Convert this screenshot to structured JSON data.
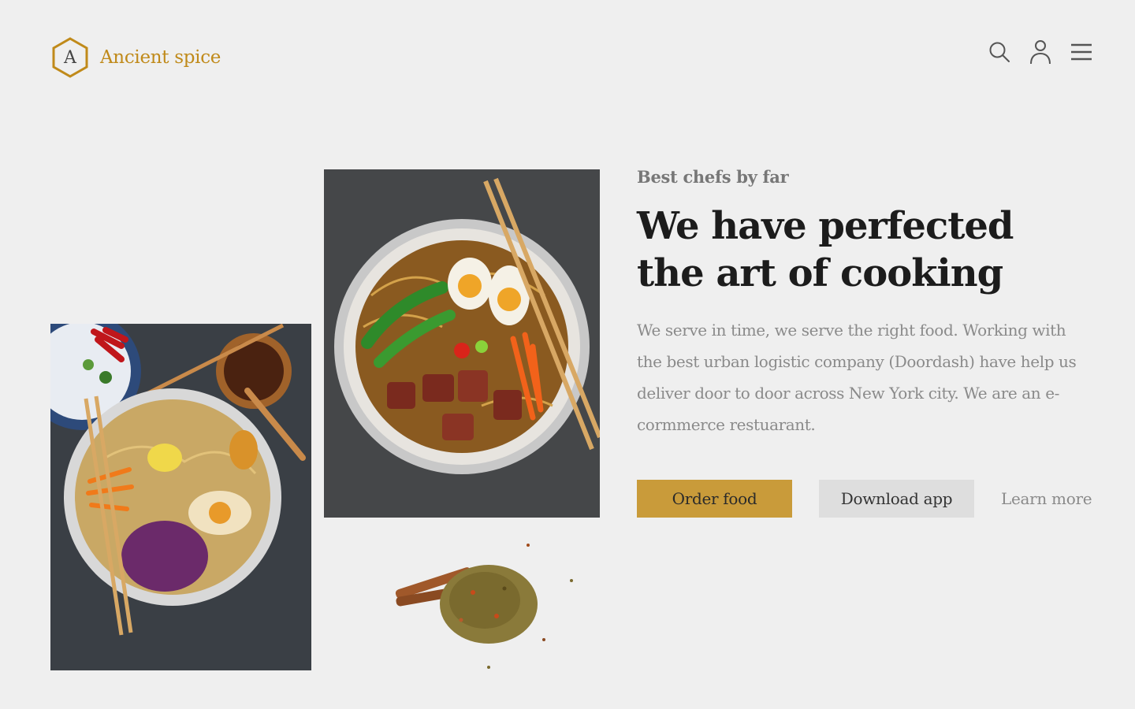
{
  "brand": {
    "logo_letter": "A",
    "name": "Ancient spice",
    "accent_color": "#c08a1a"
  },
  "header": {
    "icons": [
      "search-icon",
      "user-icon",
      "menu-icon"
    ]
  },
  "hero": {
    "eyebrow": "Best chefs by far",
    "headline": "We have perfected the art of cooking",
    "body": "We serve in time, we serve the right food. Working with the best urban logistic company (Doordash) have help us deliver door to door across New York city. We are an e-cormmerce restuarant."
  },
  "actions": {
    "primary_label": "Order food",
    "secondary_label": "Download app",
    "link_label": "Learn more",
    "primary_color": "#c99b3a"
  },
  "images": [
    "ramen-bowl-with-cabbage",
    "ramen-bowl-with-pork-belly",
    "spice-pile-with-cinnamon"
  ]
}
